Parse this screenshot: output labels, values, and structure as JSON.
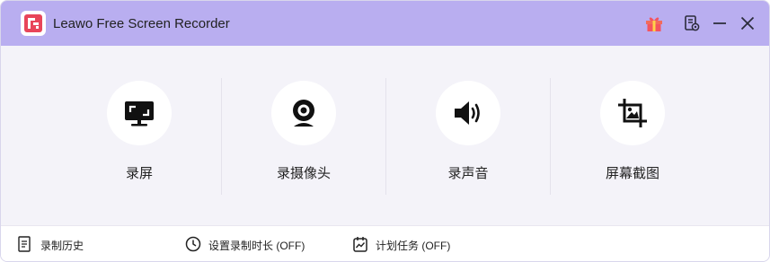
{
  "window": {
    "title": "Leawo Free Screen Recorder",
    "titlebar_color": "#b9aef0",
    "icons": [
      "app-logo-icon",
      "gift-icon",
      "document-settings-icon",
      "minimize-icon",
      "close-icon"
    ]
  },
  "tools": [
    {
      "label": "录屏",
      "icon": "monitor-screen-record-icon"
    },
    {
      "label": "录摄像头",
      "icon": "webcam-icon"
    },
    {
      "label": "录声音",
      "icon": "speaker-icon"
    },
    {
      "label": "屏幕截图",
      "icon": "screenshot-crop-icon"
    }
  ],
  "footer": {
    "history": "录制历史",
    "timer": "设置录制时长 (OFF)",
    "schedule": "计划任务 (OFF)"
  }
}
